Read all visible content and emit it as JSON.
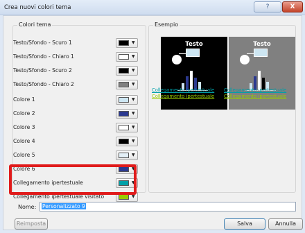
{
  "window": {
    "title": "Crea nuovi colori tema",
    "help_label": "?",
    "close_label": "X"
  },
  "colors_group": {
    "legend": "Colori tema",
    "items": [
      {
        "label": "Testo/Sfondo - Scuro 1",
        "color": "#000000"
      },
      {
        "label": "Testo/Sfondo - Chiaro 1",
        "color": "#ffffff"
      },
      {
        "label": "Testo/Sfondo - Scuro 2",
        "color": "#000000"
      },
      {
        "label": "Testo/Sfondo - Chiaro 2",
        "color": "#808080"
      },
      {
        "label": "Colore 1",
        "color": "#cde6f2"
      },
      {
        "label": "Colore 2",
        "color": "#2b3990"
      },
      {
        "label": "Colore 3",
        "color": "#ffffff"
      },
      {
        "label": "Colore 4",
        "color": "#000000"
      },
      {
        "label": "Colore 5",
        "color": "#e4f0f7"
      },
      {
        "label": "Colore 6",
        "color": "#2b3990"
      },
      {
        "label": "Collegamento ipertestuale",
        "color": "#00a0a8"
      },
      {
        "label": "Collegamento ipertestuale visitato",
        "color": "#99cc00"
      }
    ]
  },
  "example_group": {
    "legend": "Esempio",
    "title": "Testo",
    "hyperlink": "Collegamento ipertestuale",
    "visited": "Collegamento ipertestuale",
    "dark_bg": "#000000",
    "gray_bg": "#808080",
    "hyperlink_color": "#00a0a8",
    "visited_color": "#99cc00"
  },
  "name_field": {
    "label": "Nome:",
    "value": "Personalizzato 9"
  },
  "buttons": {
    "reset": "Reimposta",
    "save": "Salva",
    "cancel": "Annulla"
  },
  "icons": {
    "dropdown": "chevron-down-icon"
  }
}
